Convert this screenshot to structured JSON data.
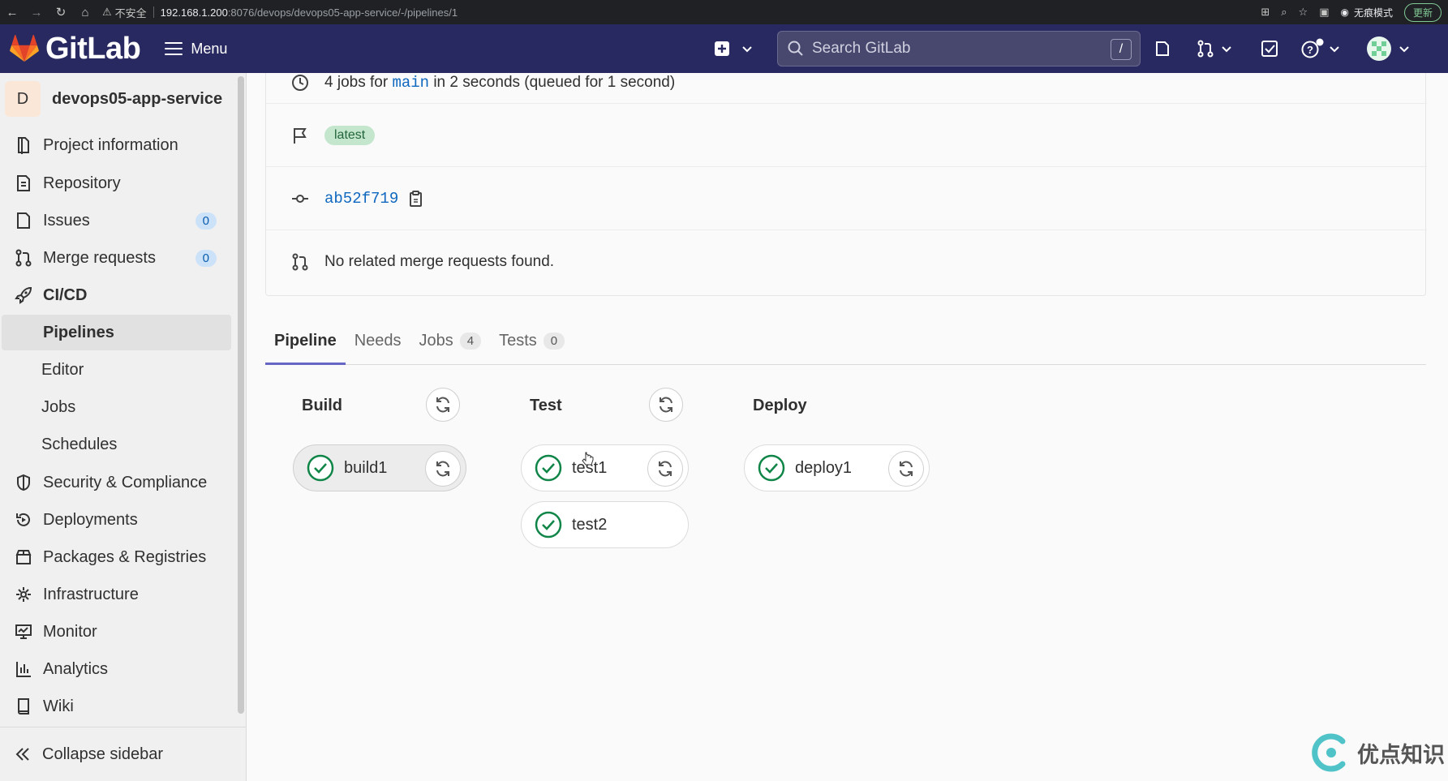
{
  "browser": {
    "security_label": "不安全",
    "url_host": "192.168.1.200",
    "url_rest": ":8076/devops/devops05-app-service/-/pipelines/1",
    "incognito_label": "无痕模式",
    "update_label": "更新"
  },
  "header": {
    "brand": "GitLab",
    "menu_label": "Menu",
    "search_placeholder": "Search GitLab",
    "search_shortcut": "/"
  },
  "sidebar": {
    "project_initial": "D",
    "project_name": "devops05-app-service",
    "items": [
      {
        "label": "Project information",
        "icon": "project-icon"
      },
      {
        "label": "Repository",
        "icon": "repository-icon"
      },
      {
        "label": "Issues",
        "icon": "issues-icon",
        "badge": "0"
      },
      {
        "label": "Merge requests",
        "icon": "merge-request-icon",
        "badge": "0"
      },
      {
        "label": "CI/CD",
        "icon": "rocket-icon"
      }
    ],
    "cicd_sub": [
      "Pipelines",
      "Editor",
      "Jobs",
      "Schedules"
    ],
    "items2": [
      {
        "label": "Security & Compliance",
        "icon": "shield-icon"
      },
      {
        "label": "Deployments",
        "icon": "deployments-icon"
      },
      {
        "label": "Packages & Registries",
        "icon": "package-icon"
      },
      {
        "label": "Infrastructure",
        "icon": "infrastructure-icon"
      },
      {
        "label": "Monitor",
        "icon": "monitor-icon"
      },
      {
        "label": "Analytics",
        "icon": "analytics-icon"
      },
      {
        "label": "Wiki",
        "icon": "wiki-icon"
      }
    ],
    "collapse_label": "Collapse sidebar"
  },
  "pipeline_info": {
    "jobs_text_pre": "4 jobs for",
    "jobs_branch": "main",
    "jobs_text_post": "in 2 seconds (queued for 1 second)",
    "tag": "latest",
    "commit_sha": "ab52f719",
    "merge_text": "No related merge requests found."
  },
  "tabs": [
    {
      "label": "Pipeline",
      "active": true
    },
    {
      "label": "Needs"
    },
    {
      "label": "Jobs",
      "count": "4"
    },
    {
      "label": "Tests",
      "count": "0"
    }
  ],
  "stages": [
    {
      "name": "Build",
      "jobs": [
        "build1"
      ]
    },
    {
      "name": "Test",
      "jobs": [
        "test1",
        "test2"
      ]
    },
    {
      "name": "Deploy",
      "jobs": [
        "deploy1"
      ]
    }
  ],
  "watermark": "优点知识",
  "colors": {
    "header": "#292961",
    "success": "#108548",
    "link": "#1068bf",
    "tab_active": "#6666c4"
  }
}
